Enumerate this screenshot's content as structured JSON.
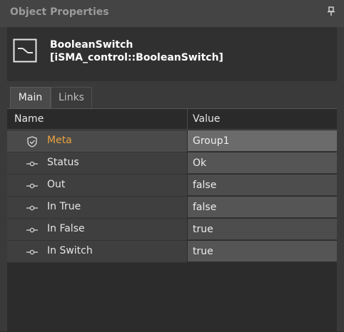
{
  "panel": {
    "title": "Object Properties",
    "pin_icon": "pin-icon"
  },
  "object": {
    "name": "BooleanSwitch",
    "type": "[iSMA_control::BooleanSwitch]",
    "icon": "boolean-switch-icon"
  },
  "tabs": [
    {
      "label": "Main",
      "active": true
    },
    {
      "label": "Links",
      "active": false
    }
  ],
  "table": {
    "columns": [
      "Name",
      "Value"
    ],
    "rows": [
      {
        "name": "Meta",
        "value": "Group1",
        "icon": "shield-icon"
      },
      {
        "name": "Status",
        "value": "Ok",
        "icon": "slot-icon"
      },
      {
        "name": "Out",
        "value": "false",
        "icon": "slot-icon"
      },
      {
        "name": "In True",
        "value": "false",
        "icon": "slot-icon"
      },
      {
        "name": "In False",
        "value": "true",
        "icon": "slot-icon"
      },
      {
        "name": "In Switch",
        "value": "true",
        "icon": "slot-icon"
      }
    ]
  },
  "colors": {
    "accent": "#e8a33d",
    "background": "#3a3a3a"
  }
}
